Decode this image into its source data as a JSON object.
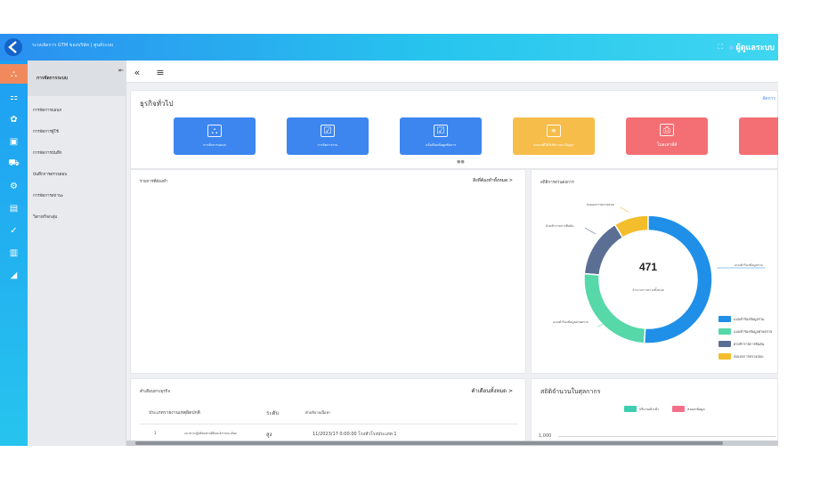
{
  "header": {
    "app_title": "ระบบจัดการ GTM ของบริษัท | ศูนย์ระบบ",
    "top_icons": "⛶",
    "user_label": "ผู้ดูแลระบบ"
  },
  "rail": {
    "items": [
      {
        "icon": "sitemap-icon",
        "glyph": "⛬"
      },
      {
        "icon": "grid-icon",
        "glyph": "⚏"
      },
      {
        "icon": "paw-icon",
        "glyph": "✿"
      },
      {
        "icon": "monitor-icon",
        "glyph": "▣"
      },
      {
        "icon": "truck-icon",
        "glyph": "⛟"
      },
      {
        "icon": "gear-icon",
        "glyph": "⚙"
      },
      {
        "icon": "document-icon",
        "glyph": "▤"
      },
      {
        "icon": "check-circle-icon",
        "glyph": "✓"
      },
      {
        "icon": "clipboard-icon",
        "glyph": "▥"
      },
      {
        "icon": "chart-icon",
        "glyph": "◢"
      }
    ]
  },
  "sidebar": {
    "title": "การจัดการระบบ",
    "items": [
      "การจัดการแผนก",
      "การจัดการผู้ใช้",
      "การจัดการบันทึก",
      "บันทึกการตรวจสอบ",
      "การจัดการสถานะ",
      "วิสาหกิจกลุ่ม"
    ]
  },
  "tabbar": {
    "collapse_glyph": "«",
    "menu_glyph": "≡"
  },
  "general": {
    "title": "ธุรกิจทั่วไป",
    "manage_link": "จัดการ",
    "cards": [
      {
        "label": "การจัดการแผนก",
        "glyph": "⛬",
        "color": "#3d86f0"
      },
      {
        "label": "การจัดการงาน",
        "glyph": "☑",
        "color": "#3d86f0"
      },
      {
        "label": "แจ้งเตือนข้อผูกพันการ",
        "glyph": "☑",
        "color": "#3d86f0"
      },
      {
        "label": "ผลงานที่ได้รับพิจารณาปัญญา",
        "glyph": "⌖",
        "color": "#f6bd4b"
      },
      {
        "label": "โบลเลาส์ส์",
        "glyph": "⎙",
        "color": "#f36f73"
      },
      {
        "label": "",
        "glyph": "",
        "color": "#f36f73"
      }
    ],
    "dots": "●●"
  },
  "todo": {
    "title": "รายการที่ต้องทำ",
    "link": "สิ่งที่ต้องทำทั้งหมด >"
  },
  "stats": {
    "title": "สถิติการส่วนต่อการ",
    "center_value": "471",
    "center_label": "จำนวนการตรวจทั้งหมด",
    "callouts": [
      "ส่งออกการตรวจสอบ",
      "ฝ่ายข้าราชการยืนยัน",
      "แบบคำร้องข้อมูลฝ่ายตรวจ",
      "แบบคำร้องข้อมูลร่วม"
    ],
    "chart_data": {
      "type": "pie",
      "values": [
        240,
        120,
        70,
        41
      ],
      "colors": [
        "#1f8fe8",
        "#56d8a8",
        "#5b6e93",
        "#f4bd2b"
      ],
      "labels": [
        "แบบคำร้องข้อมูลร่วม",
        "แบบคำร้องข้อมูลฝ่ายตรวจ",
        "ฝ่ายข้าราชการยืนยัน",
        "ส่งออกการตรวจสอบ"
      ]
    }
  },
  "notices": {
    "title": "คำเตือนทางธุรกิจ",
    "link": "คำเตือนทั้งหมด >",
    "columns": [
      "ประเภทรายงานเหตุผิดปกติ",
      "ระดับ",
      "คำอธิบายเนื้อหา"
    ],
    "row": {
      "index": "1",
      "type": "แนวทางปฏิบัติต่อส่วนที่ต้องแจ้งรายละเอียด",
      "level": "สูง",
      "desc": "11/2023/17 0:00:00 โรงหัวโรงประเภท 1"
    }
  },
  "stats2": {
    "title": "สถิติจำนวนใบศุลกากร",
    "legend": [
      {
        "label": "ปริมาณนำเข้า",
        "color": "#3dcfb0"
      },
      {
        "label": "ส่งออกข้อมูล",
        "color": "#f36f8a"
      }
    ],
    "y_tick": "1,000"
  }
}
